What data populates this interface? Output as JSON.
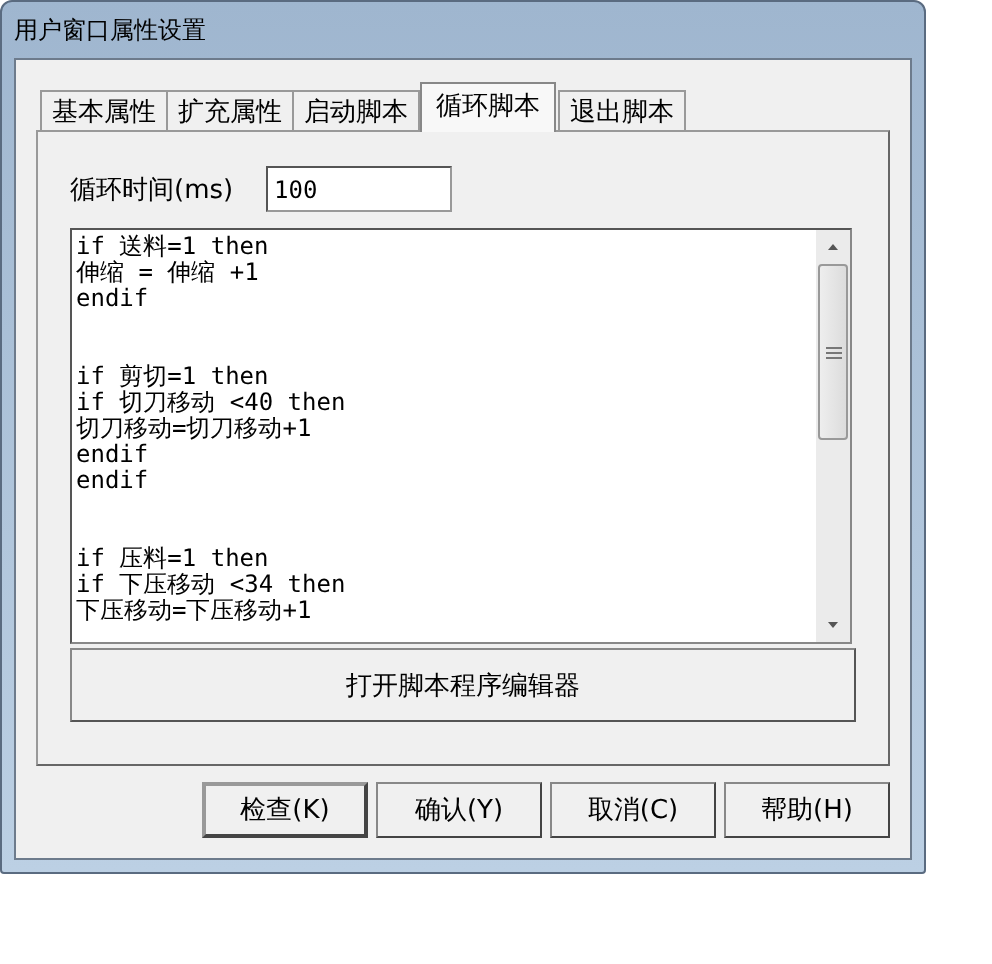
{
  "window": {
    "title": "用户窗口属性设置"
  },
  "tabs": [
    {
      "label": "基本属性",
      "selected": false
    },
    {
      "label": "扩充属性",
      "selected": false
    },
    {
      "label": "启动脚本",
      "selected": false
    },
    {
      "label": "循环脚本",
      "selected": true
    },
    {
      "label": "退出脚本",
      "selected": false
    }
  ],
  "cycle_time": {
    "label": "循环时间(ms)",
    "value": "100"
  },
  "script_editor": {
    "text": "if 送料=1 then\n伸缩 = 伸缩 +1\nendif\n\n\nif 剪切=1 then\nif 切刀移动 <40 then\n切刀移动=切刀移动+1\nendif\nendif\n\n\nif 压料=1 then\nif 下压移动 <34 then\n下压移动=下压移动+1"
  },
  "open_editor_button": "打开脚本程序编辑器",
  "buttons": [
    "检查(K)",
    "确认(Y)",
    "取消(C)",
    "帮助(H)"
  ]
}
